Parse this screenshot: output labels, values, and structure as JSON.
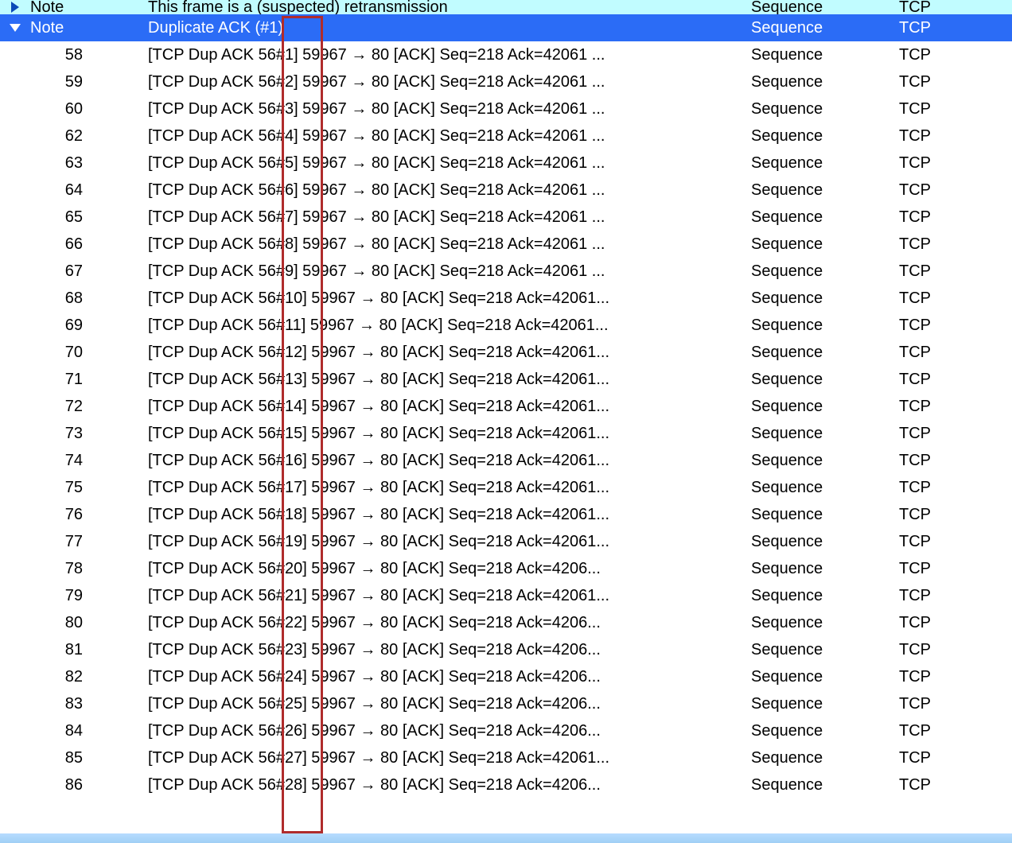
{
  "top": {
    "note_label": "Note",
    "info": "This frame is a (suspected) retransmission",
    "seq": "Sequence",
    "proto": "TCP"
  },
  "header": {
    "note_label": "Note",
    "info": "Duplicate ACK (#1)",
    "seq": "Sequence",
    "proto": "TCP"
  },
  "rows": [
    {
      "no": "58",
      "info": "[TCP Dup ACK 56#1] 59967 → 80 [ACK] Seq=218 Ack=42061 ...",
      "seq": "Sequence",
      "proto": "TCP"
    },
    {
      "no": "59",
      "info": "[TCP Dup ACK 56#2] 59967 → 80 [ACK] Seq=218 Ack=42061 ...",
      "seq": "Sequence",
      "proto": "TCP"
    },
    {
      "no": "60",
      "info": "[TCP Dup ACK 56#3] 59967 → 80 [ACK] Seq=218 Ack=42061 ...",
      "seq": "Sequence",
      "proto": "TCP"
    },
    {
      "no": "62",
      "info": "[TCP Dup ACK 56#4] 59967 → 80 [ACK] Seq=218 Ack=42061 ...",
      "seq": "Sequence",
      "proto": "TCP"
    },
    {
      "no": "63",
      "info": "[TCP Dup ACK 56#5] 59967 → 80 [ACK] Seq=218 Ack=42061 ...",
      "seq": "Sequence",
      "proto": "TCP"
    },
    {
      "no": "64",
      "info": "[TCP Dup ACK 56#6] 59967 → 80 [ACK] Seq=218 Ack=42061 ...",
      "seq": "Sequence",
      "proto": "TCP"
    },
    {
      "no": "65",
      "info": "[TCP Dup ACK 56#7] 59967 → 80 [ACK] Seq=218 Ack=42061 ...",
      "seq": "Sequence",
      "proto": "TCP"
    },
    {
      "no": "66",
      "info": "[TCP Dup ACK 56#8] 59967 → 80 [ACK] Seq=218 Ack=42061 ...",
      "seq": "Sequence",
      "proto": "TCP"
    },
    {
      "no": "67",
      "info": "[TCP Dup ACK 56#9] 59967 → 80 [ACK] Seq=218 Ack=42061 ...",
      "seq": "Sequence",
      "proto": "TCP"
    },
    {
      "no": "68",
      "info": "[TCP Dup ACK 56#10] 59967 → 80 [ACK] Seq=218 Ack=42061...",
      "seq": "Sequence",
      "proto": "TCP"
    },
    {
      "no": "69",
      "info": "[TCP Dup ACK 56#11] 59967 → 80 [ACK] Seq=218 Ack=42061...",
      "seq": "Sequence",
      "proto": "TCP"
    },
    {
      "no": "70",
      "info": "[TCP Dup ACK 56#12] 59967 → 80 [ACK] Seq=218 Ack=42061...",
      "seq": "Sequence",
      "proto": "TCP"
    },
    {
      "no": "71",
      "info": "[TCP Dup ACK 56#13] 59967 → 80 [ACK] Seq=218 Ack=42061...",
      "seq": "Sequence",
      "proto": "TCP"
    },
    {
      "no": "72",
      "info": "[TCP Dup ACK 56#14] 59967 → 80 [ACK] Seq=218 Ack=42061...",
      "seq": "Sequence",
      "proto": "TCP"
    },
    {
      "no": "73",
      "info": "[TCP Dup ACK 56#15] 59967 → 80 [ACK] Seq=218 Ack=42061...",
      "seq": "Sequence",
      "proto": "TCP"
    },
    {
      "no": "74",
      "info": "[TCP Dup ACK 56#16] 59967 → 80 [ACK] Seq=218 Ack=42061...",
      "seq": "Sequence",
      "proto": "TCP"
    },
    {
      "no": "75",
      "info": "[TCP Dup ACK 56#17] 59967 → 80 [ACK] Seq=218 Ack=42061...",
      "seq": "Sequence",
      "proto": "TCP"
    },
    {
      "no": "76",
      "info": "[TCP Dup ACK 56#18] 59967 → 80 [ACK] Seq=218 Ack=42061...",
      "seq": "Sequence",
      "proto": "TCP"
    },
    {
      "no": "77",
      "info": "[TCP Dup ACK 56#19] 59967 → 80 [ACK] Seq=218 Ack=42061...",
      "seq": "Sequence",
      "proto": "TCP"
    },
    {
      "no": "78",
      "info": "[TCP Dup ACK 56#20] 59967 → 80 [ACK] Seq=218 Ack=4206...",
      "seq": "Sequence",
      "proto": "TCP"
    },
    {
      "no": "79",
      "info": "[TCP Dup ACK 56#21] 59967 → 80 [ACK] Seq=218 Ack=42061...",
      "seq": "Sequence",
      "proto": "TCP"
    },
    {
      "no": "80",
      "info": "[TCP Dup ACK 56#22] 59967 → 80 [ACK] Seq=218 Ack=4206...",
      "seq": "Sequence",
      "proto": "TCP"
    },
    {
      "no": "81",
      "info": "[TCP Dup ACK 56#23] 59967 → 80 [ACK] Seq=218 Ack=4206...",
      "seq": "Sequence",
      "proto": "TCP"
    },
    {
      "no": "82",
      "info": "[TCP Dup ACK 56#24] 59967 → 80 [ACK] Seq=218 Ack=4206...",
      "seq": "Sequence",
      "proto": "TCP"
    },
    {
      "no": "83",
      "info": "[TCP Dup ACK 56#25] 59967 → 80 [ACK] Seq=218 Ack=4206...",
      "seq": "Sequence",
      "proto": "TCP"
    },
    {
      "no": "84",
      "info": "[TCP Dup ACK 56#26] 59967 → 80 [ACK] Seq=218 Ack=4206...",
      "seq": "Sequence",
      "proto": "TCP"
    },
    {
      "no": "85",
      "info": "[TCP Dup ACK 56#27] 59967 → 80 [ACK] Seq=218 Ack=42061...",
      "seq": "Sequence",
      "proto": "TCP"
    },
    {
      "no": "86",
      "info": "[TCP Dup ACK 56#28] 59967 → 80 [ACK] Seq=218 Ack=4206...",
      "seq": "Sequence",
      "proto": "TCP"
    }
  ]
}
